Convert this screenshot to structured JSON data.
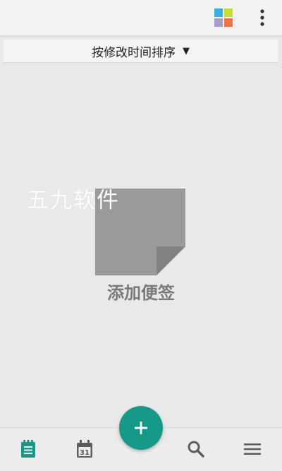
{
  "sort": {
    "label": "按修改时间排序",
    "arrow": "▼"
  },
  "empty_state": {
    "label": "添加便签",
    "icon": "sticky-note-icon"
  },
  "watermark": "五九软件",
  "calendar_day": "31",
  "icons": {
    "color_palette": "color-grid-icon",
    "more": "more-vertical-icon",
    "notes_tab": "notes-list-icon",
    "calendar_tab": "calendar-icon",
    "add": "plus-icon",
    "search": "search-icon",
    "menu": "menu-icon"
  },
  "colors": {
    "accent": "#17998a",
    "palette": [
      "#3ab0e2",
      "#c7dd35",
      "#a79bc9",
      "#f37048"
    ],
    "note": "#9a9a9a",
    "note_fold": "#828282",
    "icon_gray": "#5d5d5d"
  }
}
